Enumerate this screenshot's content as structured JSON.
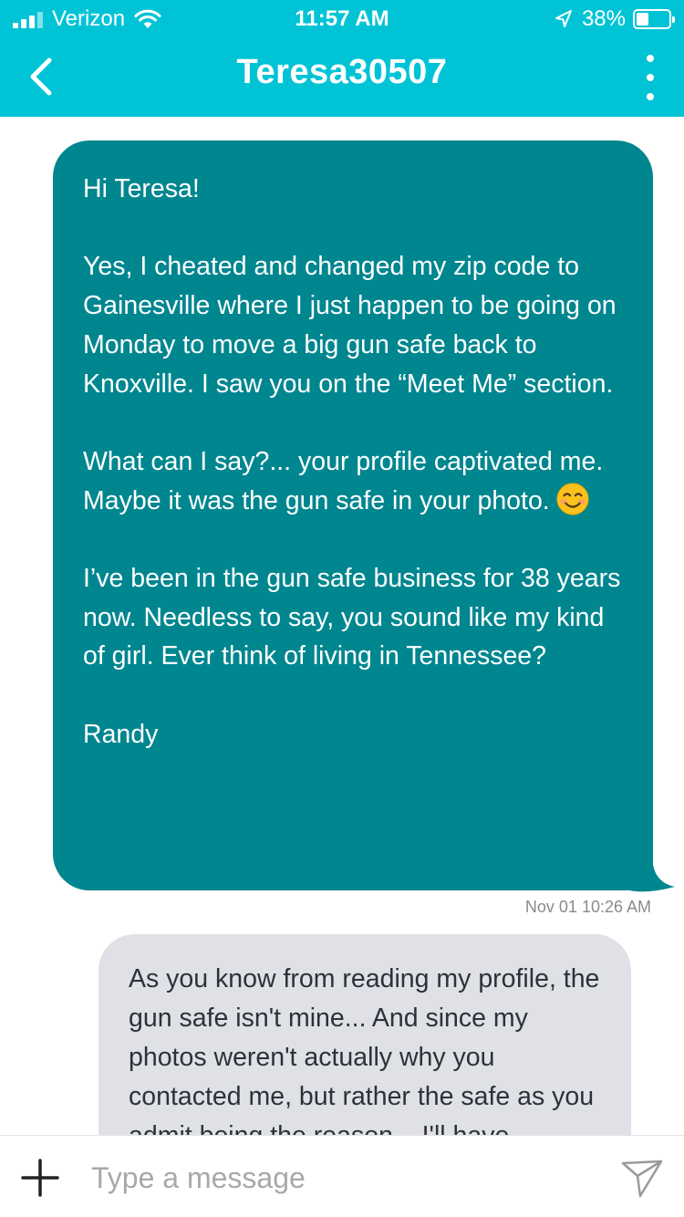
{
  "status_bar": {
    "carrier": "Verizon",
    "time": "11:57 AM",
    "battery_percent": "38%",
    "battery_level": 0.38,
    "icons": [
      "signal-icon",
      "wifi-icon",
      "location-arrow-icon",
      "battery-icon"
    ]
  },
  "header": {
    "title": "Teresa30507",
    "back_icon": "chevron-left-icon",
    "menu_icon": "more-vertical-icon",
    "background_color": "#00c4d6"
  },
  "messages": [
    {
      "direction": "outgoing",
      "bubble_color": "#00868f",
      "paragraphs": [
        "Hi Teresa!",
        "Yes, I cheated and changed my zip code to Gainesville where I just happen to be going on Monday to move a big gun safe back to Knoxville.  I saw you on the “Meet Me” section.",
        "What can I say?... your profile captivated me.  Maybe it was the gun safe in your photo.",
        "I’ve been in the gun safe business for 38 years now.  Needless to say, you sound like my kind of girl.  Ever think of living in Tennessee?",
        "Randy"
      ],
      "emoji": "smiling-face-emoji",
      "timestamp": "Nov 01 10:26 AM"
    },
    {
      "direction": "incoming",
      "bubble_color": "#dfe1e6",
      "text": "As you know from reading my profile, the gun safe isn't mine... And since my photos weren't actually why you contacted me, but rather the safe as you admit being the reason... I'll have"
    }
  ],
  "composer": {
    "placeholder": "Type a message",
    "value": "",
    "add_icon": "plus-icon",
    "send_icon": "send-icon"
  }
}
